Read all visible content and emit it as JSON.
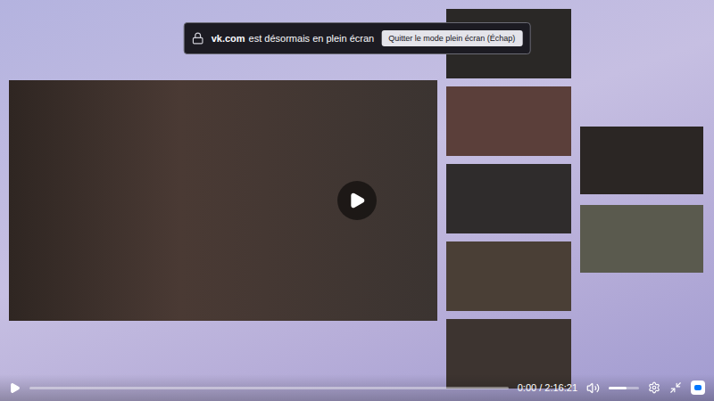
{
  "notification": {
    "domain": "vk.com",
    "message": "est désormais en plein écran",
    "button": "Quitter le mode plein écran (Échap)"
  },
  "player": {
    "playing": false,
    "progress": {
      "level": 0
    },
    "time": "0:00 / 2:16:21",
    "volume": {
      "level": 0.6,
      "muted": false
    }
  }
}
